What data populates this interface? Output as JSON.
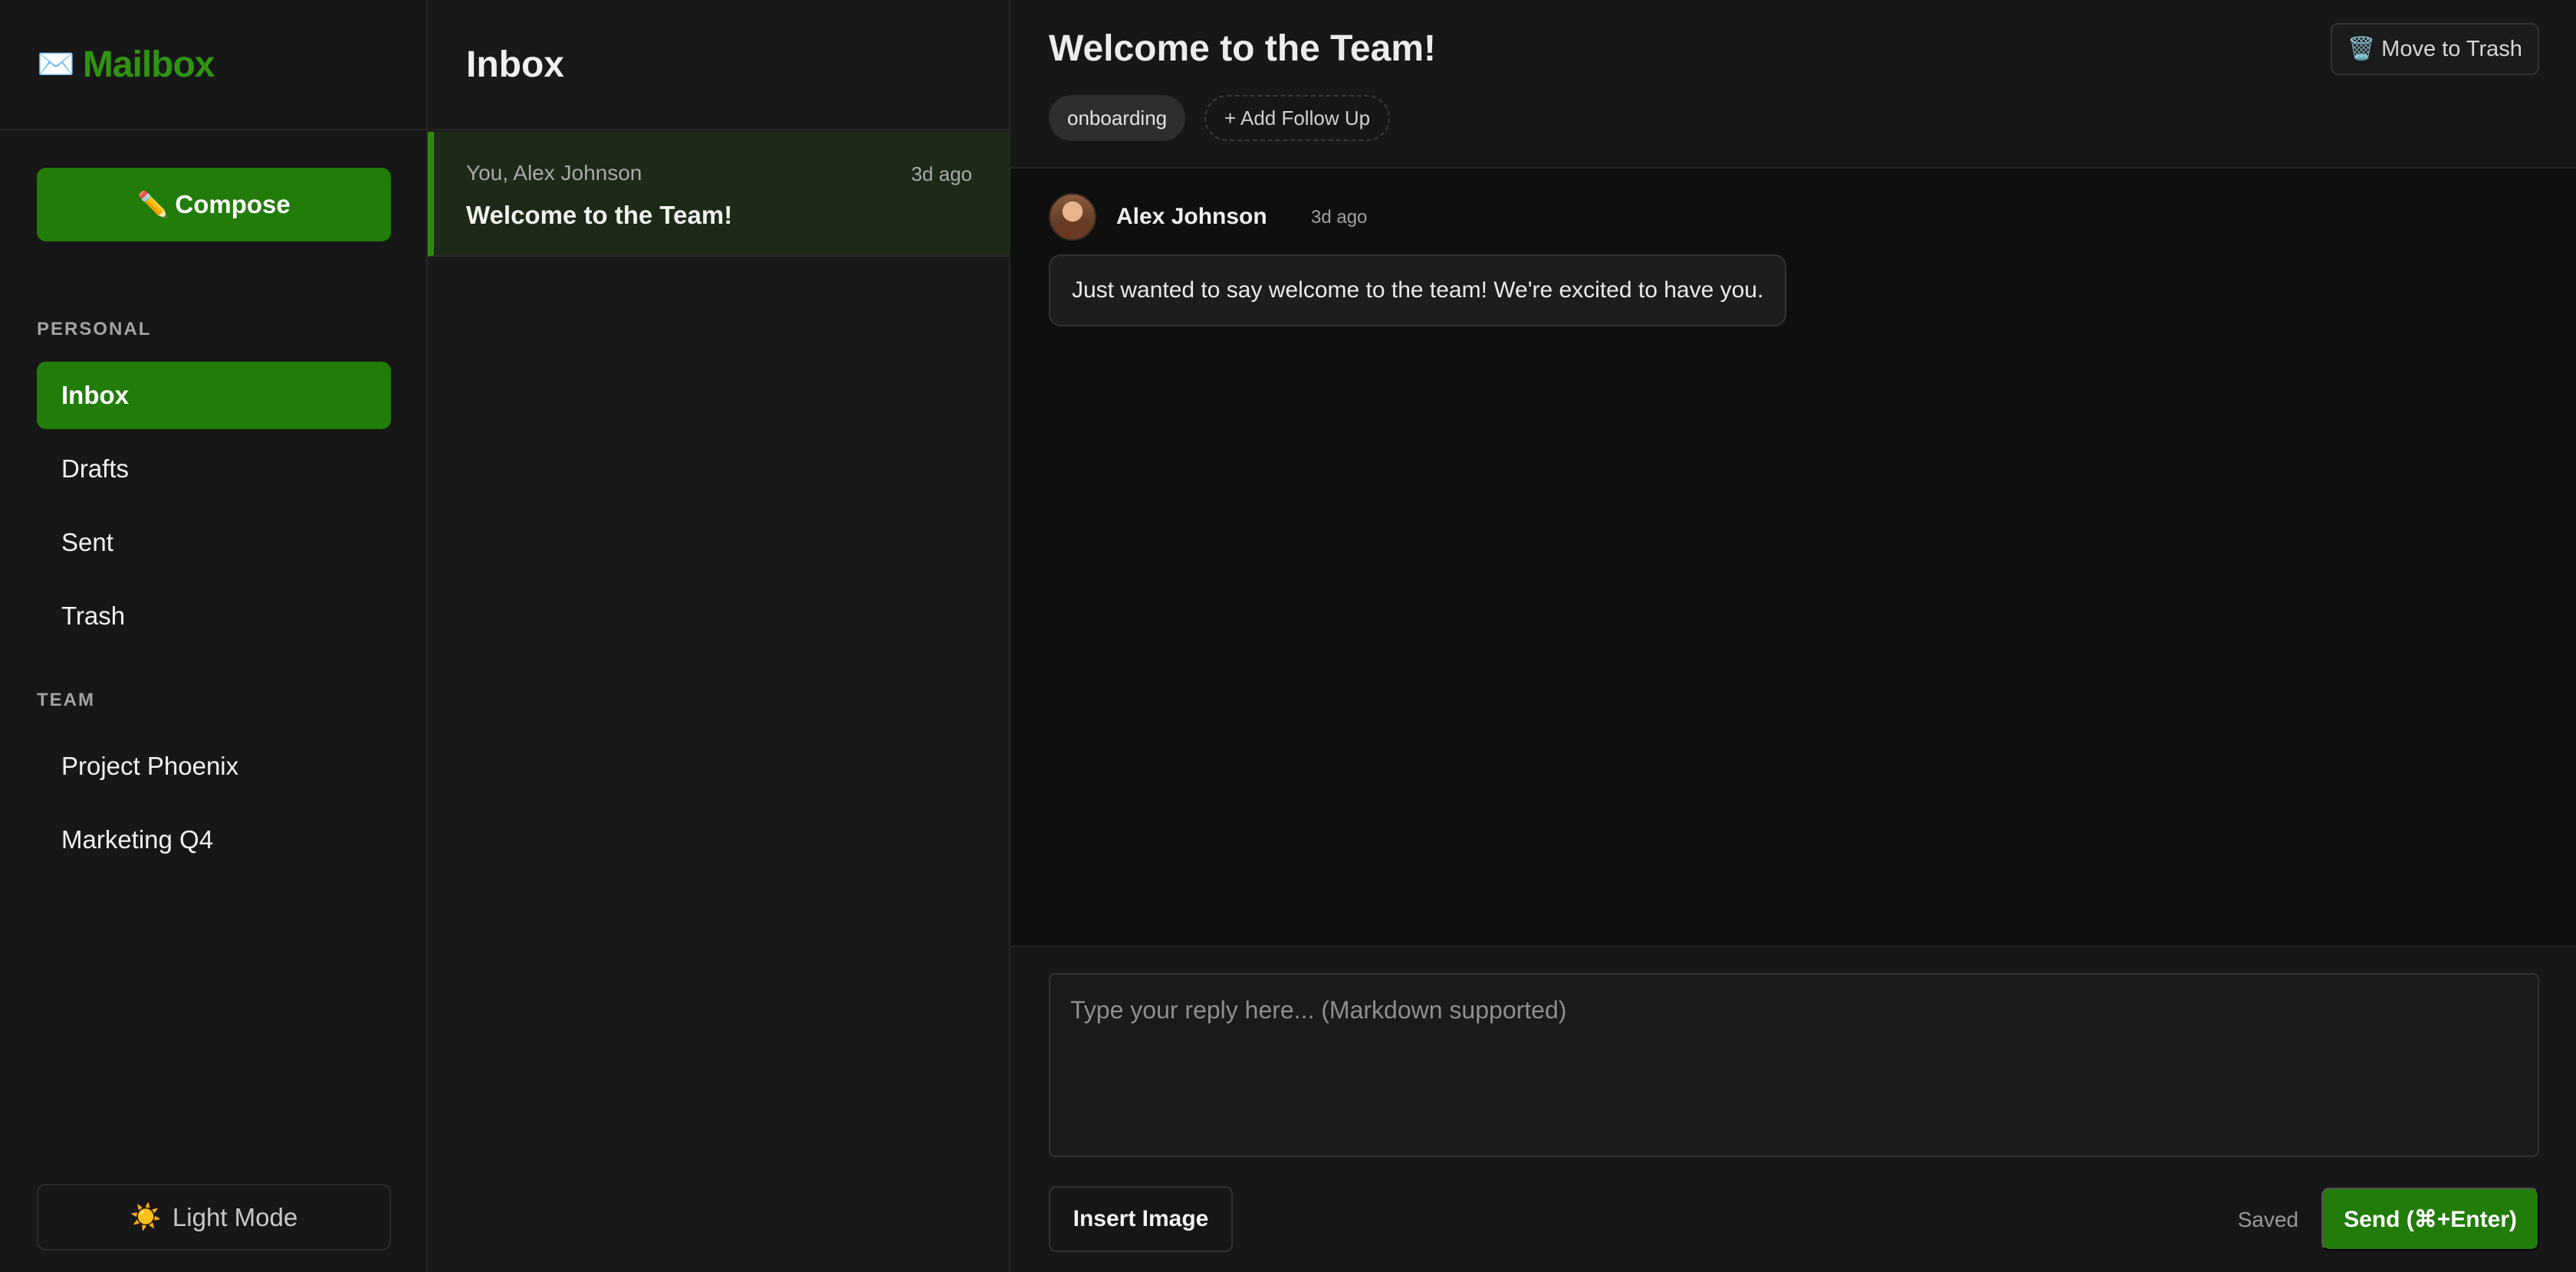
{
  "brand": {
    "icon": "✉️",
    "title": "Mailbox"
  },
  "sidebar": {
    "compose": {
      "icon": "✏️",
      "label": "Compose"
    },
    "sections": [
      {
        "label": "PERSONAL",
        "items": [
          "Inbox",
          "Drafts",
          "Sent",
          "Trash"
        ]
      },
      {
        "label": "TEAM",
        "items": [
          "Project Phoenix",
          "Marketing Q4"
        ]
      }
    ],
    "active_item": "Inbox",
    "light_mode": {
      "icon": "☀️",
      "label": "Light Mode"
    }
  },
  "list": {
    "title": "Inbox",
    "threads": [
      {
        "participants": "You, Alex Johnson",
        "time": "3d ago",
        "subject": "Welcome to the Team!",
        "selected": true
      }
    ]
  },
  "detail": {
    "subject": "Welcome to the Team!",
    "trash_button": {
      "icon": "🗑️",
      "label": "Move to Trash"
    },
    "tags": [
      "onboarding"
    ],
    "add_follow_up": "+ Add Follow Up",
    "messages": [
      {
        "sender": "Alex Johnson",
        "time": "3d ago",
        "avatar": "avatar-photo",
        "body": "Just wanted to say welcome to the team! We're excited to have you."
      }
    ]
  },
  "reply": {
    "placeholder": "Type your reply here... (Markdown supported)",
    "value": "",
    "insert_image": "Insert Image",
    "status": "Saved",
    "send": "Send (⌘+Enter)"
  },
  "colors": {
    "accent": "#227c09",
    "brand": "#2f9412",
    "background": "#0f0f0f"
  }
}
